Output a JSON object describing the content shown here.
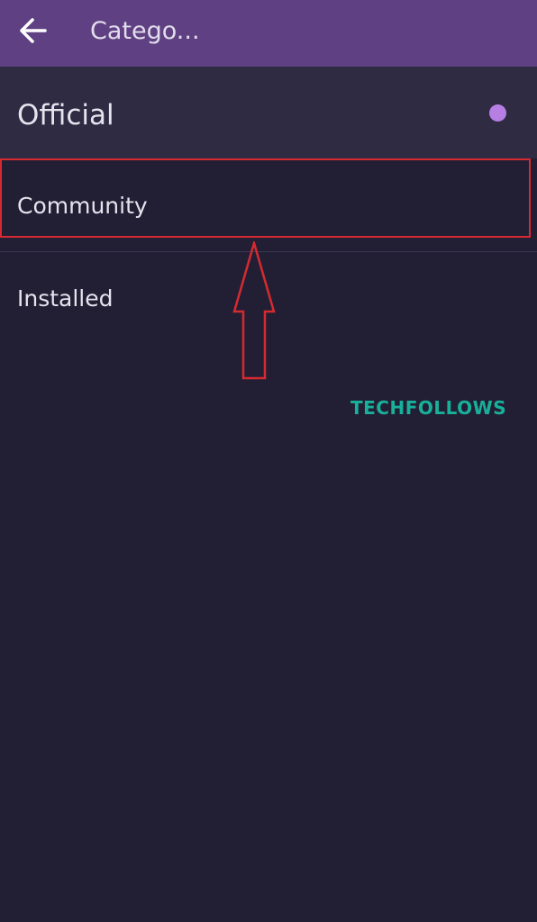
{
  "app_bar": {
    "title": "Catego...",
    "back_icon": "arrow-left-icon"
  },
  "categories": [
    {
      "label": "Official",
      "selected": true
    },
    {
      "label": "Community",
      "selected": false
    },
    {
      "label": "Installed",
      "selected": false
    }
  ],
  "annotation": {
    "highlight_color": "#d62a31",
    "arrow_icon": "arrow-up-outline-icon"
  },
  "watermark": {
    "text": "TECHFOLLOWS",
    "color": "#19b09b"
  },
  "colors": {
    "app_bar": "#5f4183",
    "background": "#221f34",
    "selected_row": "#2e2b43",
    "selected_dot": "#b77fe4"
  }
}
